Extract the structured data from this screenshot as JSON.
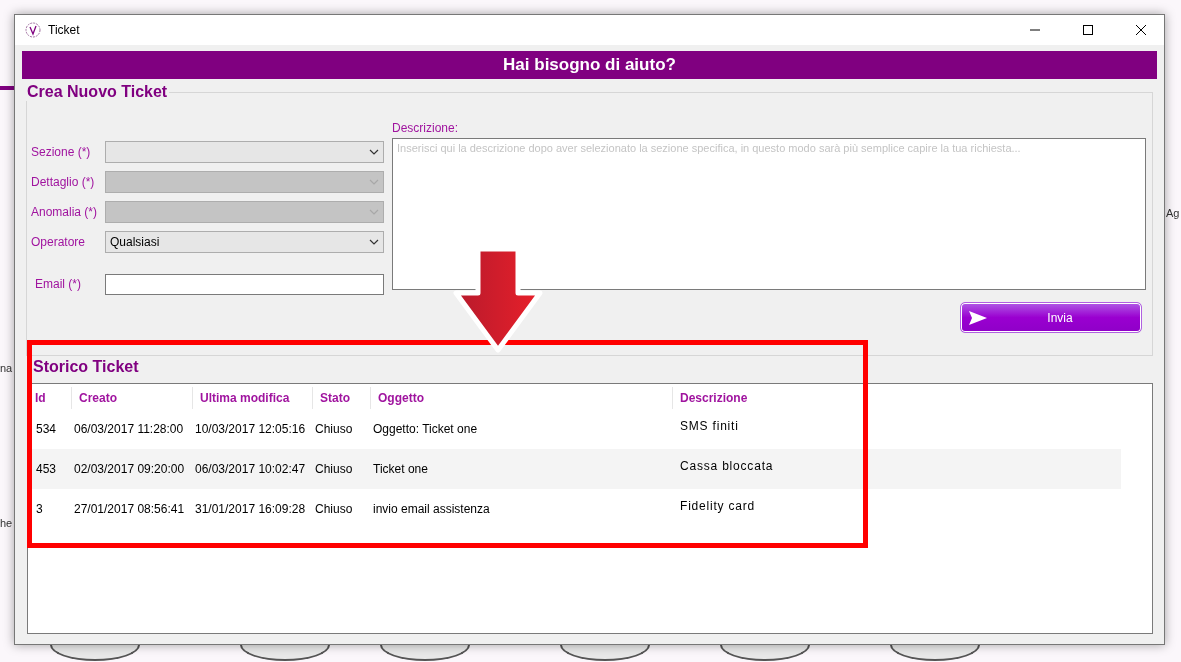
{
  "window": {
    "title": "Ticket"
  },
  "header": {
    "title": "Hai bisogno di aiuto?"
  },
  "new_ticket": {
    "title": "Crea Nuovo Ticket",
    "fields": [
      {
        "label": "Sezione (*)",
        "kind": "combo",
        "disabled": false
      },
      {
        "label": "Dettaglio (*)",
        "kind": "combo",
        "disabled": true
      },
      {
        "label": "Anomalia (*)",
        "kind": "combo",
        "disabled": true
      },
      {
        "label": "Operatore",
        "kind": "combo",
        "value": "Qualsiasi",
        "disabled": false
      },
      {
        "label": "Email (*)",
        "kind": "text"
      }
    ],
    "description": {
      "label": "Descrizione:",
      "placeholder": "Inserisci qui la descrizione dopo aver selezionato la sezione specifica, in questo modo sarà più semplice capire la tua richiesta..."
    },
    "send_button": "Invia"
  },
  "history": {
    "title": "Storico Ticket",
    "columns": [
      "Id",
      "Creato",
      "Ultima modifica",
      "Stato",
      "Oggetto",
      "Descrizione"
    ],
    "rows": [
      [
        "534",
        "06/03/2017 11:28:00",
        "10/03/2017 12:05:16",
        "Chiuso",
        "Oggetto: Ticket one",
        "SMS finiti"
      ],
      [
        "453",
        "02/03/2017 09:20:00",
        "06/03/2017 10:02:47",
        "Chiuso",
        "Ticket one",
        "Cassa bloccata"
      ],
      [
        "3",
        "27/01/2017 08:56:41",
        "31/01/2017 16:09:28",
        "Chiuso",
        "invio email assistenza",
        "Fidelity card"
      ]
    ]
  },
  "background_labels": [
    "Ag",
    "na",
    "he"
  ]
}
